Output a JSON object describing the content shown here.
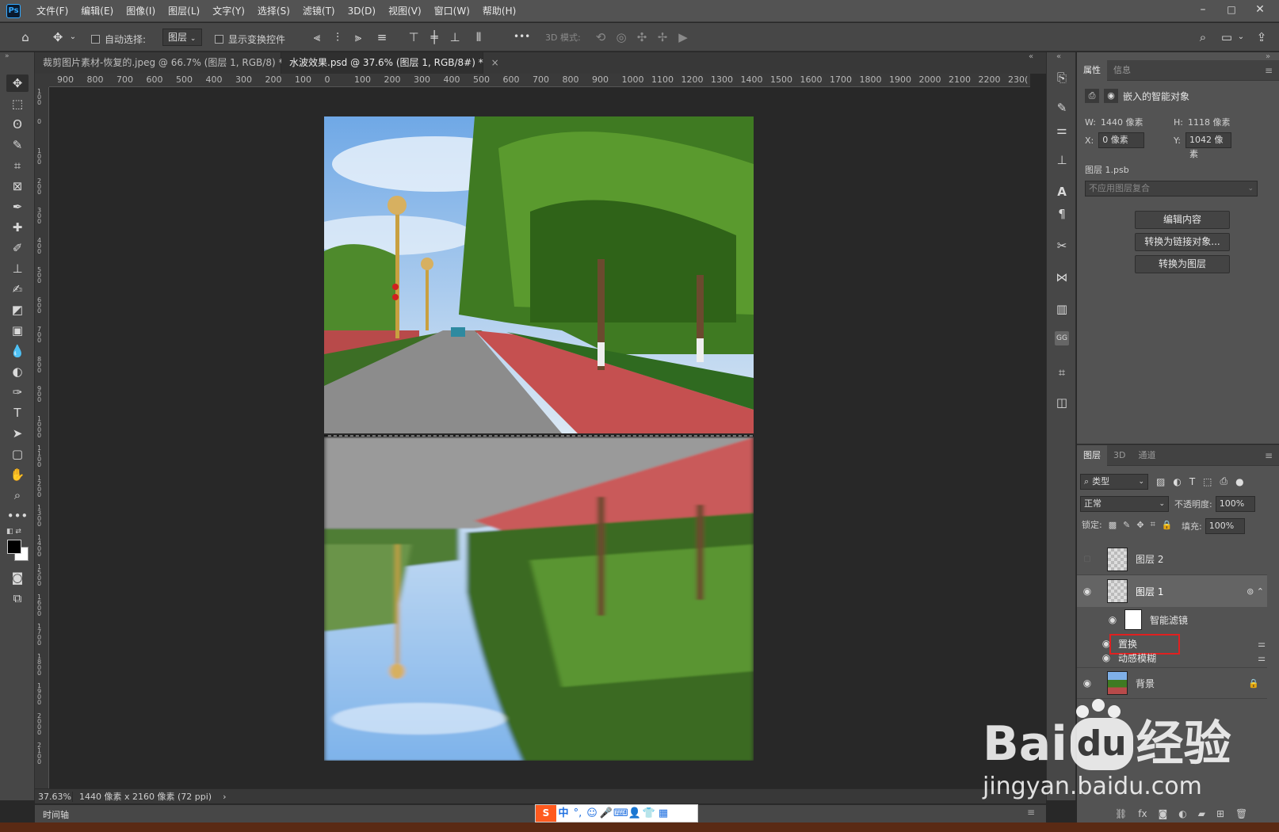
{
  "app": {
    "logo": "Ps"
  },
  "menu": [
    "文件(F)",
    "编辑(E)",
    "图像(I)",
    "图层(L)",
    "文字(Y)",
    "选择(S)",
    "滤镜(T)",
    "3D(D)",
    "视图(V)",
    "窗口(W)",
    "帮助(H)"
  ],
  "window_controls": {
    "minimize": "–",
    "maximize": "□",
    "close": "✕"
  },
  "options": {
    "auto_select_label": "自动选择:",
    "auto_select_target": "图层",
    "show_transform_label": "显示变换控件",
    "more": "•••",
    "mode_3d_label": "3D 模式:"
  },
  "tabs": [
    {
      "label": "裁剪图片素材-恢复的.jpeg @ 66.7% (图层 1, RGB/8) *",
      "active": false
    },
    {
      "label": "水波效果.psd @ 37.6% (图层 1, RGB/8#) *",
      "active": true
    }
  ],
  "ruler_h": [
    "900",
    "800",
    "700",
    "600",
    "500",
    "400",
    "300",
    "200",
    "100",
    "0",
    "100",
    "200",
    "300",
    "400",
    "500",
    "600",
    "700",
    "800",
    "900",
    "1000",
    "1100",
    "1200",
    "1300",
    "1400",
    "1500",
    "1600",
    "1700",
    "1800",
    "1900",
    "2000",
    "2100",
    "2200",
    "230("
  ],
  "ruler_v": [
    "1 0 0",
    "0",
    "1 0 0",
    "2 0 0",
    "3 0 0",
    "4 0 0",
    "5 0 0",
    "6 0 0",
    "7 0 0",
    "8 0 0",
    "9 0 0",
    "1 0 0 0",
    "1 1 0 0",
    "1 2 0 0",
    "1 3 0 0",
    "1 4 0 0",
    "1 5 0 0",
    "1 6 0 0",
    "1 7 0 0",
    "1 8 0 0",
    "1 9 0 0",
    "2 0 0 0",
    "2 1 0 0"
  ],
  "status": {
    "zoom": "37.63%",
    "doc_info": "1440 像素 x 2160 像素 (72 ppi)",
    "arrow": "›"
  },
  "timeline": {
    "label": "时间轴"
  },
  "properties": {
    "tabs": [
      "属性",
      "信息"
    ],
    "type_label": "嵌入的智能对象",
    "w_label": "W:",
    "w_value": "1440 像素",
    "h_label": "H:",
    "h_value": "1118 像素",
    "x_label": "X:",
    "x_value": "0 像素",
    "y_label": "Y:",
    "y_value": "1042 像素",
    "file_label": "图层 1.psb",
    "comp_placeholder": "不应用图层复合",
    "buttons": [
      "编辑内容",
      "转换为链接对象...",
      "转换为图层"
    ]
  },
  "layers_panel": {
    "tabs": [
      "图层",
      "3D",
      "通道"
    ],
    "filter_kind": "类型",
    "blend_mode": "正常",
    "opacity_label": "不透明度:",
    "opacity_value": "100%",
    "lock_label": "锁定:",
    "fill_label": "填充:",
    "fill_value": "100%",
    "layers": [
      {
        "name": "图层 2",
        "visible": false
      },
      {
        "name": "图层 1",
        "visible": true,
        "selected": true
      },
      {
        "name": "背景",
        "visible": true,
        "locked": true
      }
    ],
    "smart_filters_label": "智能滤镜",
    "filters": [
      "置换",
      "动感模糊"
    ]
  },
  "watermark": {
    "brand": "Bai",
    "brand2": "du",
    "name": "经验",
    "url": "jingyan.baidu.com"
  },
  "ime": {
    "items": [
      "中",
      "°,",
      "☺",
      "🎤",
      "⌨",
      "👤",
      "👕",
      "▦"
    ]
  },
  "colors": {
    "accent": "#31a8ff",
    "highlight_box": "#e02020",
    "panel_bg": "#535353"
  }
}
